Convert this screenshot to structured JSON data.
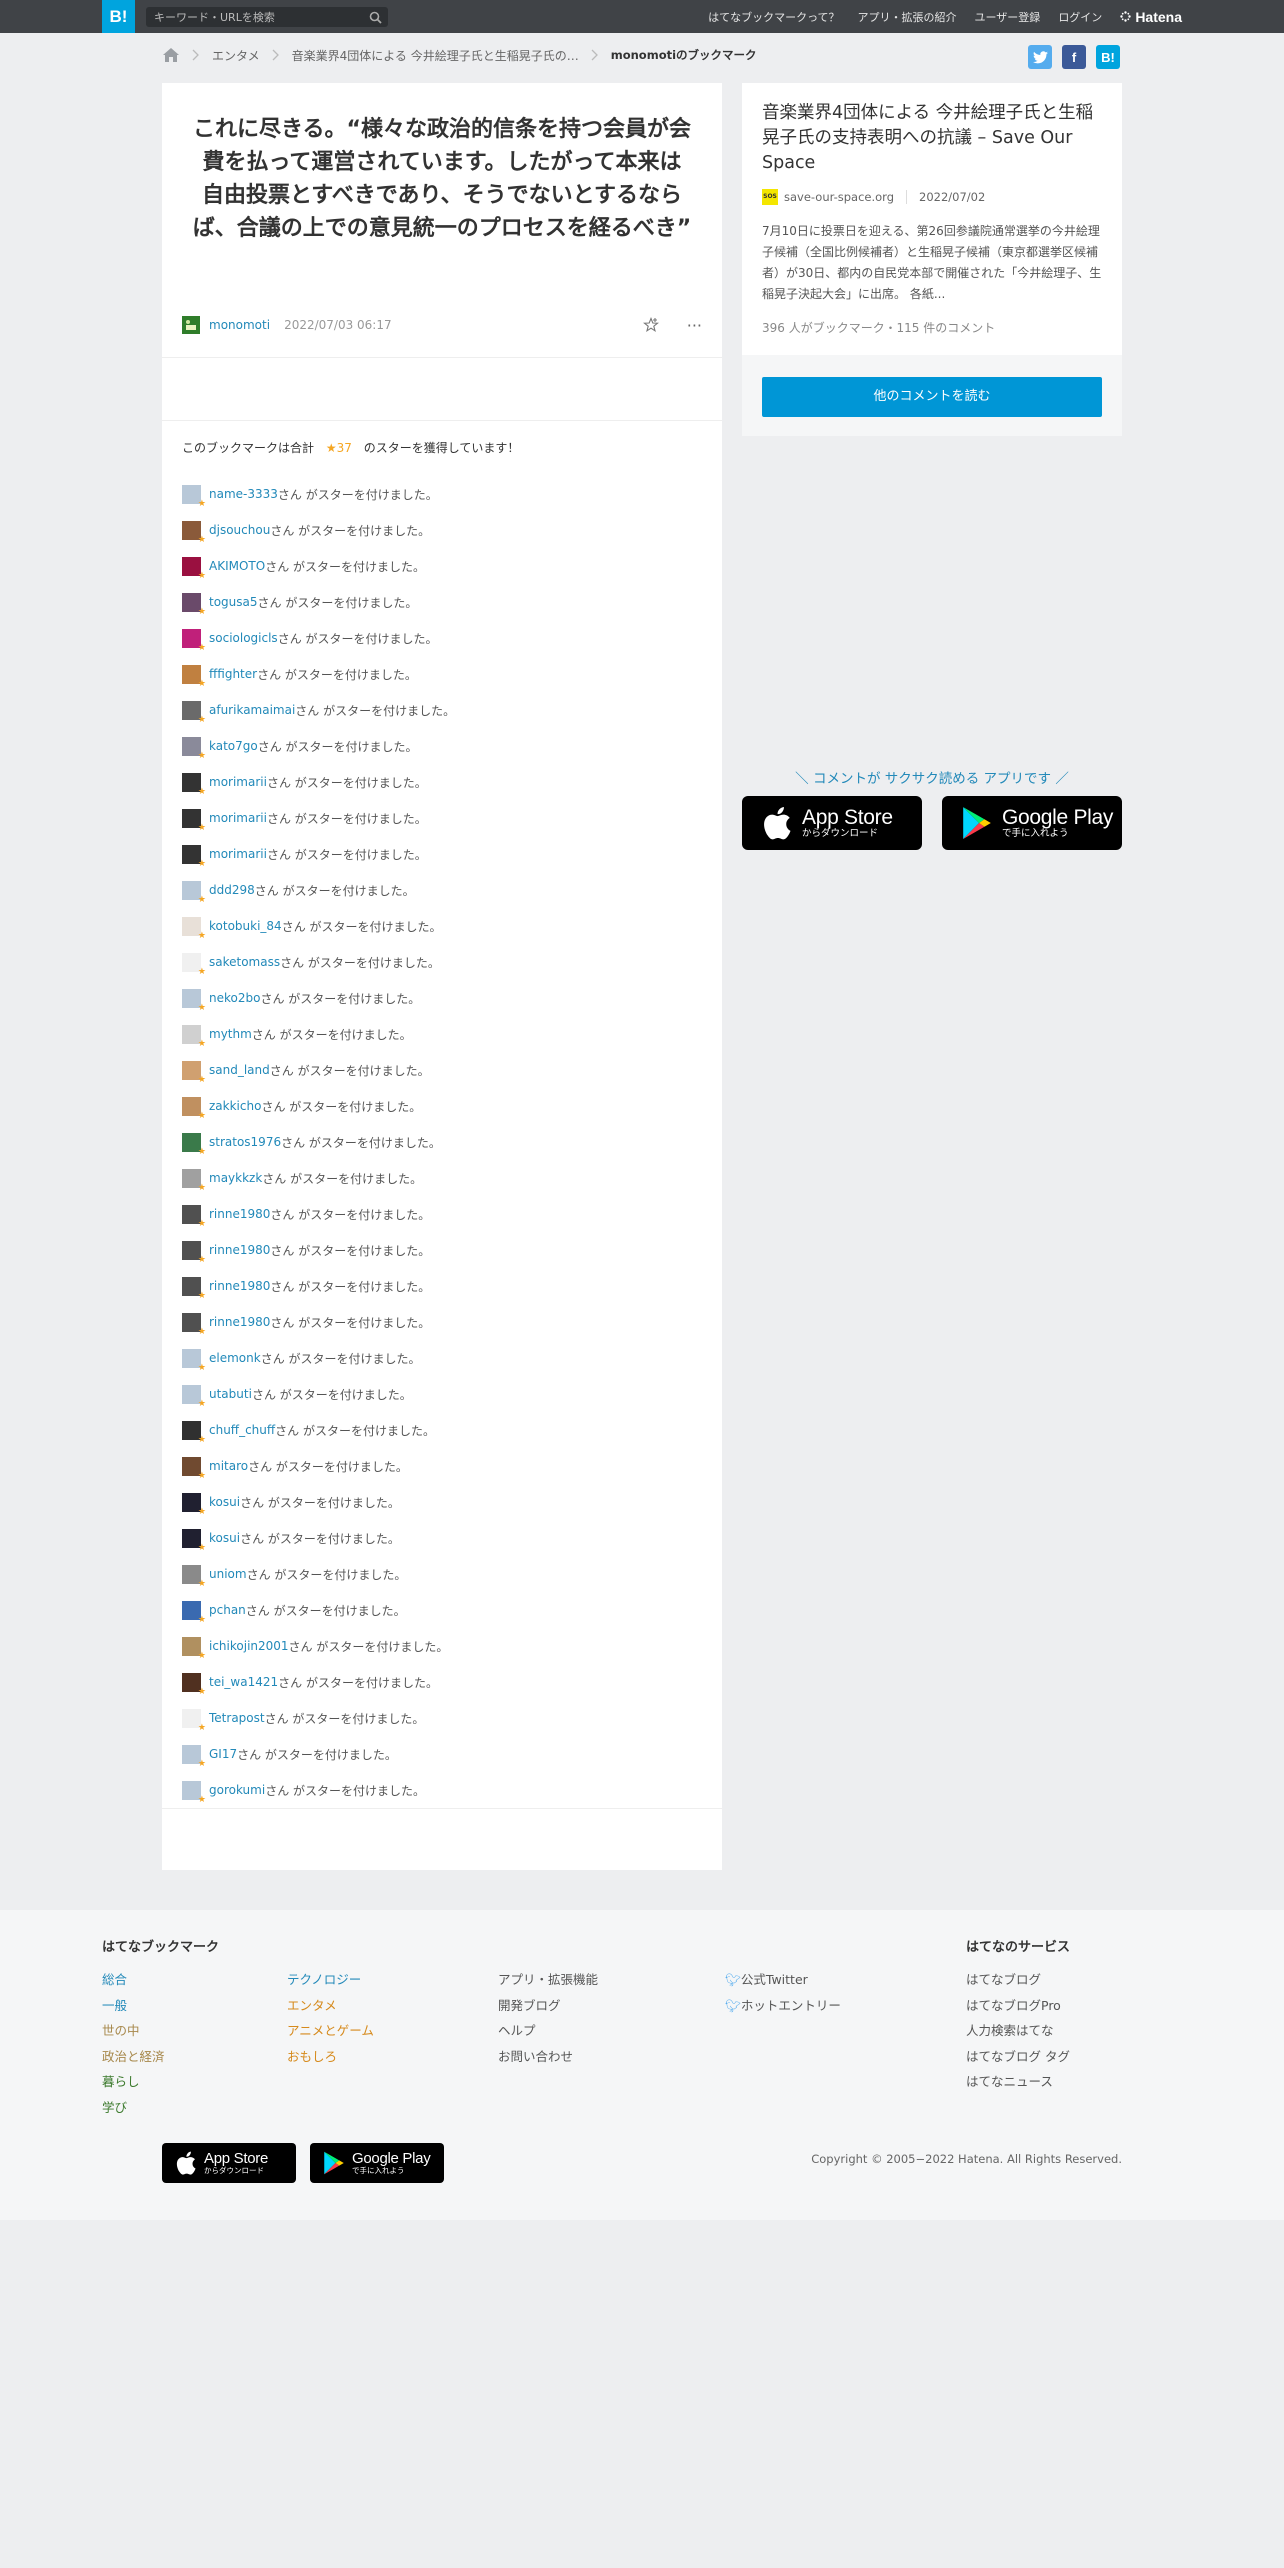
{
  "topbar": {
    "logo": "B!",
    "search_placeholder": "キーワード・URLを検索",
    "nav": [
      "はてなブックマークって？",
      "アプリ・拡張の紹介",
      "ユーザー登録",
      "ログイン"
    ],
    "brand": "Hatena"
  },
  "breadcrumb": {
    "items": [
      "エンタメ",
      "音楽業界4団体による 今井絵理子氏と生稲晃子氏の…"
    ],
    "current": "monomotiのブックマーク"
  },
  "share": [
    "Twitter",
    "Facebook",
    "B!"
  ],
  "bookmark": {
    "comment": "これに尽きる。“様々な政治的信条を持つ会員が会費を払って運営されています。したがって本来は自由投票とすべきであり、そうでないとするならば、合議の上での意見統一のプロセスを経るべき”",
    "user": "monomoti",
    "date": "2022/07/03 06:17",
    "star_summary_pre": "このブックマークは合計",
    "star_count": "37",
    "star_summary_post": "のスターを獲得しています！"
  },
  "star_suffix": "さん がスターを付けました。",
  "stars": [
    {
      "user": "name-3333",
      "color": "#b8c8d8"
    },
    {
      "user": "djsouchou",
      "color": "#8a5a3a"
    },
    {
      "user": "AKIMOTO",
      "color": "#9a1040"
    },
    {
      "user": "togusa5",
      "color": "#6a4a6a"
    },
    {
      "user": "sociologicls",
      "color": "#c0207a"
    },
    {
      "user": "fffighter",
      "color": "#c08040"
    },
    {
      "user": "afurikamaimai",
      "color": "#6a6a6a"
    },
    {
      "user": "kato7go",
      "color": "#8a8a9a"
    },
    {
      "user": "morimarii",
      "color": "#333333"
    },
    {
      "user": "morimarii",
      "color": "#333333"
    },
    {
      "user": "morimarii",
      "color": "#333333"
    },
    {
      "user": "ddd298",
      "color": "#b8c8d8"
    },
    {
      "user": "kotobuki_84",
      "color": "#e8e0d8"
    },
    {
      "user": "saketomass",
      "color": "#f0f0f0"
    },
    {
      "user": "neko2bo",
      "color": "#b8c8d8"
    },
    {
      "user": "mythm",
      "color": "#d0d0d0"
    },
    {
      "user": "sand_land",
      "color": "#d0a070"
    },
    {
      "user": "zakkicho",
      "color": "#c09060"
    },
    {
      "user": "stratos1976",
      "color": "#3a7a4a"
    },
    {
      "user": "maykkzk",
      "color": "#a0a0a0"
    },
    {
      "user": "rinne1980",
      "color": "#505050"
    },
    {
      "user": "rinne1980",
      "color": "#505050"
    },
    {
      "user": "rinne1980",
      "color": "#505050"
    },
    {
      "user": "rinne1980",
      "color": "#505050"
    },
    {
      "user": "elemonk",
      "color": "#b8c8d8"
    },
    {
      "user": "utabuti",
      "color": "#b8c8d8"
    },
    {
      "user": "chuff_chuff",
      "color": "#303030"
    },
    {
      "user": "mitaro",
      "color": "#704a30"
    },
    {
      "user": "kosui",
      "color": "#202030"
    },
    {
      "user": "kosui",
      "color": "#202030"
    },
    {
      "user": "uniom",
      "color": "#8a8a8a"
    },
    {
      "user": "pchan",
      "color": "#3a6ab0"
    },
    {
      "user": "ichikojin2001",
      "color": "#b09060"
    },
    {
      "user": "tei_wa1421",
      "color": "#503020"
    },
    {
      "user": "Tetrapost",
      "color": "#f0f0f0"
    },
    {
      "user": "GI17",
      "color": "#b8c8d8"
    },
    {
      "user": "gorokumi",
      "color": "#b8c8d8"
    }
  ],
  "entry": {
    "title": "音楽業界4団体による 今井絵理子氏と生稲晃子氏の支持表明への抗議 – Save Our Space",
    "favicon": "SOS",
    "domain": "save-our-space.org",
    "date": "2022/07/02",
    "excerpt": "7月10日に投票日を迎える、第26回参議院通常選挙の今井絵理子候補（全国比例候補者）と生稲晃子候補（東京都選挙区候補者）が30日、都内の自民党本部で開催された「今井絵理子、生稲晃子決起大会」に出席。 各紙...",
    "stats": "396 人がブックマーク・115 件のコメント",
    "read_more": "他のコメントを読む"
  },
  "promo": {
    "text": "＼ コメントが サクサク読める アプリです ／",
    "appstore_main": "App Store",
    "appstore_sub": "からダウンロード",
    "googleplay_main": "Google Play",
    "googleplay_sub": "で手に入れよう"
  },
  "footer": {
    "heading": "はてなブックマーク",
    "col1": [
      "総合",
      "一般",
      "世の中",
      "政治と経済",
      "暮らし",
      "学び"
    ],
    "col2": [
      "テクノロジー",
      "エンタメ",
      "アニメとゲーム",
      "おもしろ"
    ],
    "col3": [
      "アプリ・拡張機能",
      "開発ブログ",
      "ヘルプ",
      "お問い合わせ"
    ],
    "col4": [
      "公式Twitter",
      "ホットエントリー"
    ],
    "services_heading": "はてなのサービス",
    "services": [
      "はてなブログ",
      "はてなブログPro",
      "人力検索はてな",
      "はてなブログ タグ",
      "はてなニュース"
    ],
    "copyright": "Copyright © 2005−2022 Hatena. All Rights Reserved."
  }
}
